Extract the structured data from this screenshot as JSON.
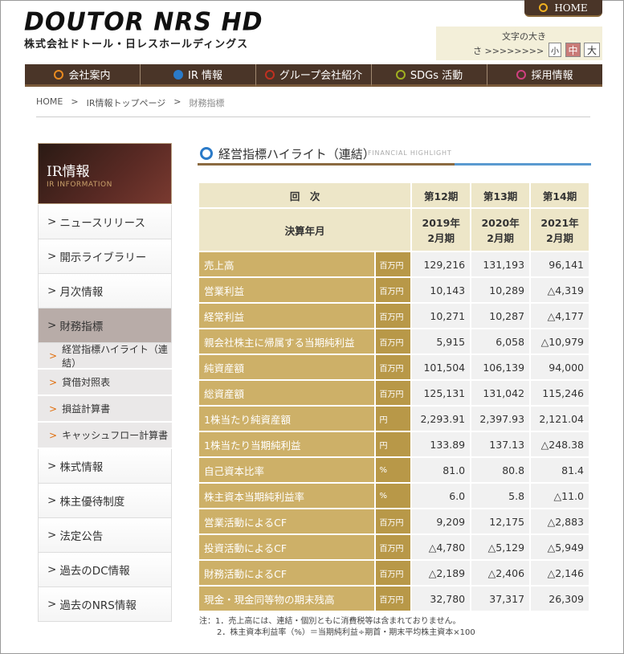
{
  "header": {
    "logo_text": "DOUTOR NRS HD",
    "company_name": "株式会社ドトール・日レスホールディングス",
    "home_label": "HOME",
    "font_size_label": "文字の大き",
    "font_size_prefix": "さ >>>>>>>>",
    "font_sizes": [
      "小",
      "中",
      "大"
    ]
  },
  "nav": [
    {
      "label": "会社案内",
      "color": "#e88a20"
    },
    {
      "label": "IR 情報",
      "color": "#2a7ac8"
    },
    {
      "label": "グループ会社紹介",
      "color": "#c03020"
    },
    {
      "label": "SDGs 活動",
      "color": "#a0b020"
    },
    {
      "label": "採用情報",
      "color": "#d04080"
    }
  ],
  "breadcrumb": {
    "home": "HOME",
    "sep": ">",
    "ir_top": "IR情報トップページ",
    "current": "財務指標"
  },
  "sidebar": {
    "title": "IR情報",
    "subtitle": "IR INFORMATION",
    "items": [
      {
        "label": "ニュースリリース"
      },
      {
        "label": "開示ライブラリー"
      },
      {
        "label": "月次情報"
      },
      {
        "label": "財務指標",
        "active": true
      }
    ],
    "sub_items": [
      {
        "label": "経営指標ハイライト（連結）"
      },
      {
        "label": "貸借対照表"
      },
      {
        "label": "損益計算書"
      },
      {
        "label": "キャッシュフロー計算書"
      }
    ],
    "items_after": [
      {
        "label": "株式情報"
      },
      {
        "label": "株主優待制度"
      },
      {
        "label": "法定公告"
      },
      {
        "label": "過去のDC情報"
      },
      {
        "label": "過去のNRS情報"
      }
    ]
  },
  "section": {
    "title": "経営指標ハイライト（連結）",
    "subtitle": "FINANCIAL HIGHLIGHT"
  },
  "table": {
    "header_period_label": "回　次",
    "header_year_label": "決算年月",
    "periods": [
      "第12期",
      "第13期",
      "第14期"
    ],
    "year_lines": [
      [
        "2019年",
        "2月期"
      ],
      [
        "2020年",
        "2月期"
      ],
      [
        "2021年",
        "2月期"
      ]
    ],
    "rows": [
      {
        "label": "売上高",
        "unit": "百万円",
        "values": [
          "129,216",
          "131,193",
          "96,141"
        ]
      },
      {
        "label": "営業利益",
        "unit": "百万円",
        "values": [
          "10,143",
          "10,289",
          "△4,319"
        ]
      },
      {
        "label": "経常利益",
        "unit": "百万円",
        "values": [
          "10,271",
          "10,287",
          "△4,177"
        ]
      },
      {
        "label": "親会社株主に帰属する当期純利益",
        "unit": "百万円",
        "values": [
          "5,915",
          "6,058",
          "△10,979"
        ]
      },
      {
        "label": "純資産額",
        "unit": "百万円",
        "values": [
          "101,504",
          "106,139",
          "94,000"
        ]
      },
      {
        "label": "総資産額",
        "unit": "百万円",
        "values": [
          "125,131",
          "131,042",
          "115,246"
        ]
      },
      {
        "label": "1株当たり純資産額",
        "unit": "円",
        "values": [
          "2,293.91",
          "2,397.93",
          "2,121.04"
        ]
      },
      {
        "label": "1株当たり当期純利益",
        "unit": "円",
        "values": [
          "133.89",
          "137.13",
          "△248.38"
        ]
      },
      {
        "label": "自己資本比率",
        "unit": "%",
        "values": [
          "81.0",
          "80.8",
          "81.4"
        ]
      },
      {
        "label": "株主資本当期純利益率",
        "unit": "%",
        "values": [
          "6.0",
          "5.8",
          "△11.0"
        ]
      },
      {
        "label": "営業活動によるCF",
        "unit": "百万円",
        "values": [
          "9,209",
          "12,175",
          "△2,883"
        ]
      },
      {
        "label": "投資活動によるCF",
        "unit": "百万円",
        "values": [
          "△4,780",
          "△5,129",
          "△5,949"
        ]
      },
      {
        "label": "財務活動によるCF",
        "unit": "百万円",
        "values": [
          "△2,189",
          "△2,406",
          "△2,146"
        ]
      },
      {
        "label": "現金・現金同等物の期末残高",
        "unit": "百万円",
        "values": [
          "32,780",
          "37,317",
          "26,309"
        ]
      }
    ]
  },
  "notes": [
    "注：1．売上高には、連結・個別ともに消費税等は含まれておりません。",
    "2．株主資本利益率（%）＝当期純利益÷期首・期末平均株主資本×100"
  ]
}
